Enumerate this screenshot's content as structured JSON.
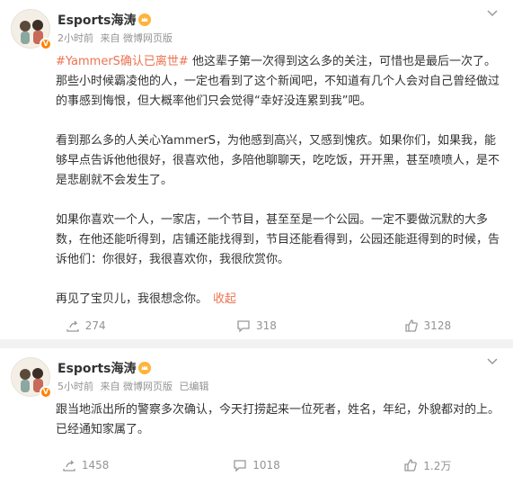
{
  "posts": [
    {
      "author": "Esports海涛",
      "meta": {
        "time": "2小时前",
        "source": "来自 微博网页版",
        "edited": ""
      },
      "topic": "#YammerS确认已离世#",
      "paragraphs": [
        "他这辈子第一次得到这么多的关注，可惜也是最后一次了。那些小时候霸凌他的人，一定也看到了这个新闻吧，不知道有几个人会对自己曾经做过的事感到悔恨，但大概率他们只会觉得“幸好没连累到我”吧。",
        "看到那么多的人关心YammerS，为他感到高兴，又感到愧疚。如果你们，如果我，能够早点告诉他他很好，很喜欢他，多陪他聊聊天，吃吃饭，开开黑，甚至喷喷人，是不是悲剧就不会发生了。",
        "如果你喜欢一个人，一家店，一个节目，甚至至是一个公园。一定不要做沉默的大多数，在他还能听得到，店铺还能找得到，节目还能看得到，公园还能逛得到的时候，告诉他们：你很好，我很喜欢你，我很欣赏你。",
        "再见了宝贝儿，我很想念你。"
      ],
      "fold_label": "收起",
      "actions": {
        "share": "274",
        "comment": "318",
        "like": "3128"
      }
    },
    {
      "author": "Esports海涛",
      "meta": {
        "time": "5小时前",
        "source": "来自 微博网页版",
        "edited": "已编辑"
      },
      "paragraphs": [
        "跟当地派出所的警察多次确认，今天打捞起来一位死者，姓名，年纪，外貌都对的上。已经通知家属了。"
      ],
      "actions": {
        "share": "1458",
        "comment": "1018",
        "like": "1.2万"
      }
    }
  ],
  "icons": [
    "avatar",
    "v-badge-icon",
    "crown-icon",
    "chevron-down-icon",
    "share-icon",
    "comment-icon",
    "like-icon"
  ],
  "colors": {
    "accent": "#eb7350",
    "vip": "#ff8200",
    "muted": "#939393",
    "text": "#333333"
  }
}
